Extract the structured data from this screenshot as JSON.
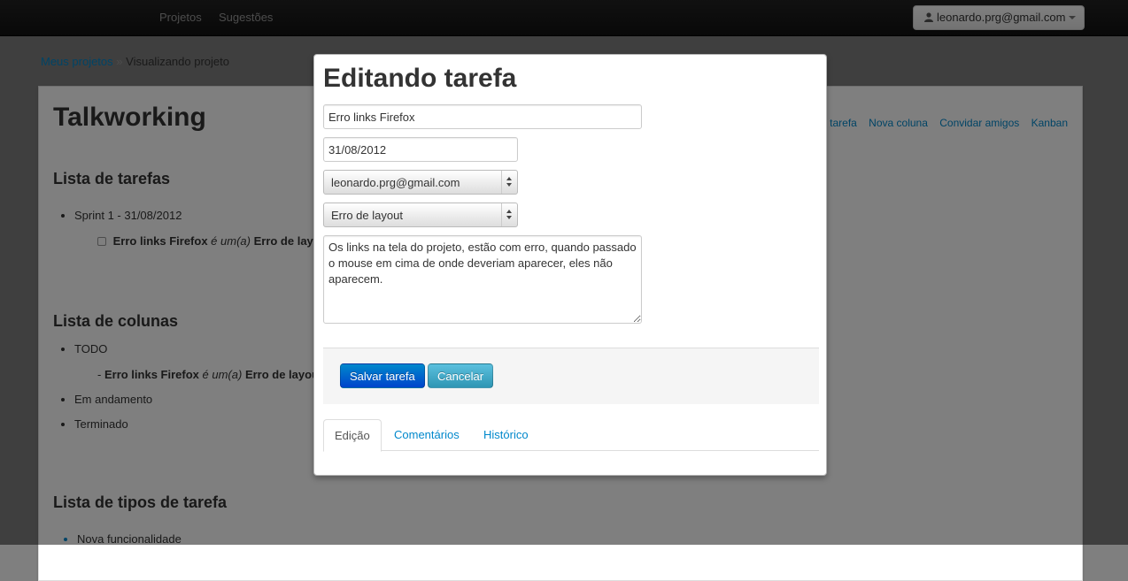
{
  "navbar": {
    "links": [
      "Projetos",
      "Sugestões"
    ],
    "user_label": "leonardo.prg@gmail.com"
  },
  "breadcrumb": {
    "parent": "Meus projetos",
    "separator": "»",
    "current": "Visualizando projeto"
  },
  "project": {
    "title": "Talkworking",
    "actions": [
      "tarefa",
      "Nova coluna",
      "Convidar amigos",
      "Kanban"
    ],
    "task_list_heading": "Lista de tarefas",
    "sprint_label": "Sprint 1 - 31/08/2012",
    "task_name": "Erro links Firefox",
    "task_connector": "é um(a)",
    "task_type_partial": "Erro de layo",
    "columns_heading": "Lista de colunas",
    "columns": [
      "TODO",
      "Em andamento",
      "Terminado"
    ],
    "column_task_prefix": "-",
    "column_task_type_partial": "Erro de layou",
    "types_heading": "Lista de tipos de tarefa",
    "types": [
      "Nova funcionalidade"
    ]
  },
  "modal": {
    "title": "Editando tarefa",
    "task_name_value": "Erro links Firefox",
    "date_value": "31/08/2012",
    "assignee_selected": "leonardo.prg@gmail.com",
    "type_selected": "Erro de layout",
    "description_value": "Os links na tela do projeto, estão com erro, quando passado o mouse em cima de onde deveriam aparecer, eles não aparecem.",
    "save_label": "Salvar tarefa",
    "cancel_label": "Cancelar",
    "tabs": [
      "Edição",
      "Comentários",
      "Histórico"
    ]
  }
}
